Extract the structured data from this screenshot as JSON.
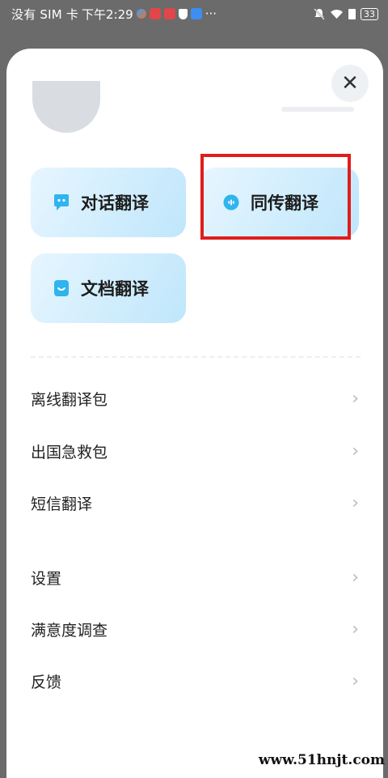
{
  "status_bar": {
    "carrier": "没有 SIM 卡",
    "time": "下午2:29",
    "more": "···",
    "battery": "33"
  },
  "colors": {
    "accent": "#2fb4ee",
    "highlight_box": "#e01d1d",
    "card_bg": "#cdeeff"
  },
  "close": {
    "icon": "close-icon",
    "glyph": "✕"
  },
  "actions": [
    {
      "label": "对话翻译",
      "icon": "chat-bubble-icon"
    },
    {
      "label": "同传翻译",
      "icon": "simultaneous-interpretation-icon"
    },
    {
      "label": "文档翻译",
      "icon": "document-icon"
    }
  ],
  "menu": [
    {
      "label": "离线翻译包"
    },
    {
      "label": "出国急救包"
    },
    {
      "label": "短信翻译"
    },
    {
      "label": "设置"
    },
    {
      "label": "满意度调查"
    },
    {
      "label": "反馈"
    }
  ],
  "chevron_glyph": "›",
  "watermark": "www.51hnjt.com"
}
